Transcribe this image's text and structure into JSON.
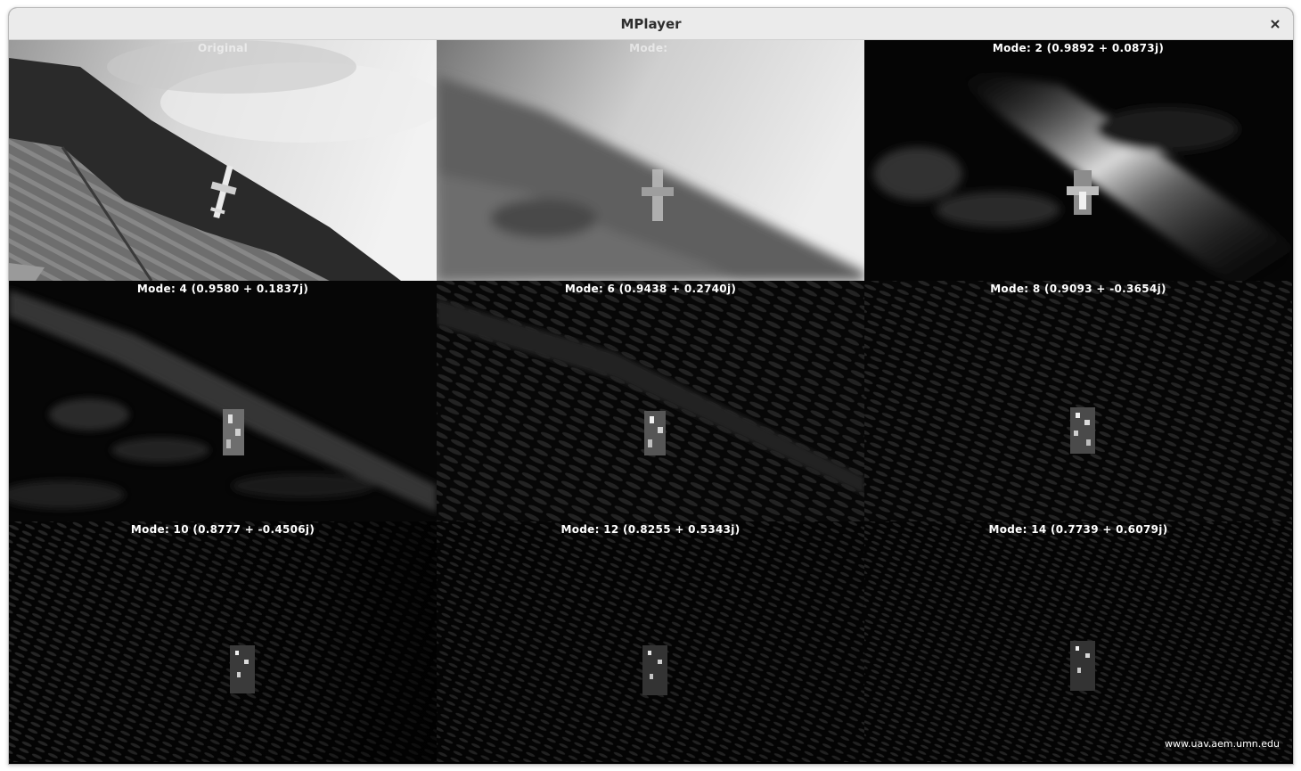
{
  "window": {
    "title": "MPlayer",
    "close_icon": "close-icon"
  },
  "panels": [
    {
      "label": "Original",
      "tone": "original"
    },
    {
      "label": "Mode: ",
      "tone": "mode0"
    },
    {
      "label": "Mode: 2 (0.9892 + 0.0873j)",
      "tone": "mode2"
    },
    {
      "label": "Mode: 4 (0.9580 + 0.1837j)",
      "tone": "dark"
    },
    {
      "label": "Mode: 6 (0.9438 + 0.2740j)",
      "tone": "dark"
    },
    {
      "label": "Mode: 8 (0.9093 + -0.3654j)",
      "tone": "dark"
    },
    {
      "label": "Mode: 10 (0.8777 + -0.4506j)",
      "tone": "darker"
    },
    {
      "label": "Mode: 12 (0.8255 + 0.5343j)",
      "tone": "darker"
    },
    {
      "label": "Mode: 14 (0.7739 + 0.6079j)",
      "tone": "darker"
    }
  ],
  "watermark": "www.uav.aem.umn.edu"
}
